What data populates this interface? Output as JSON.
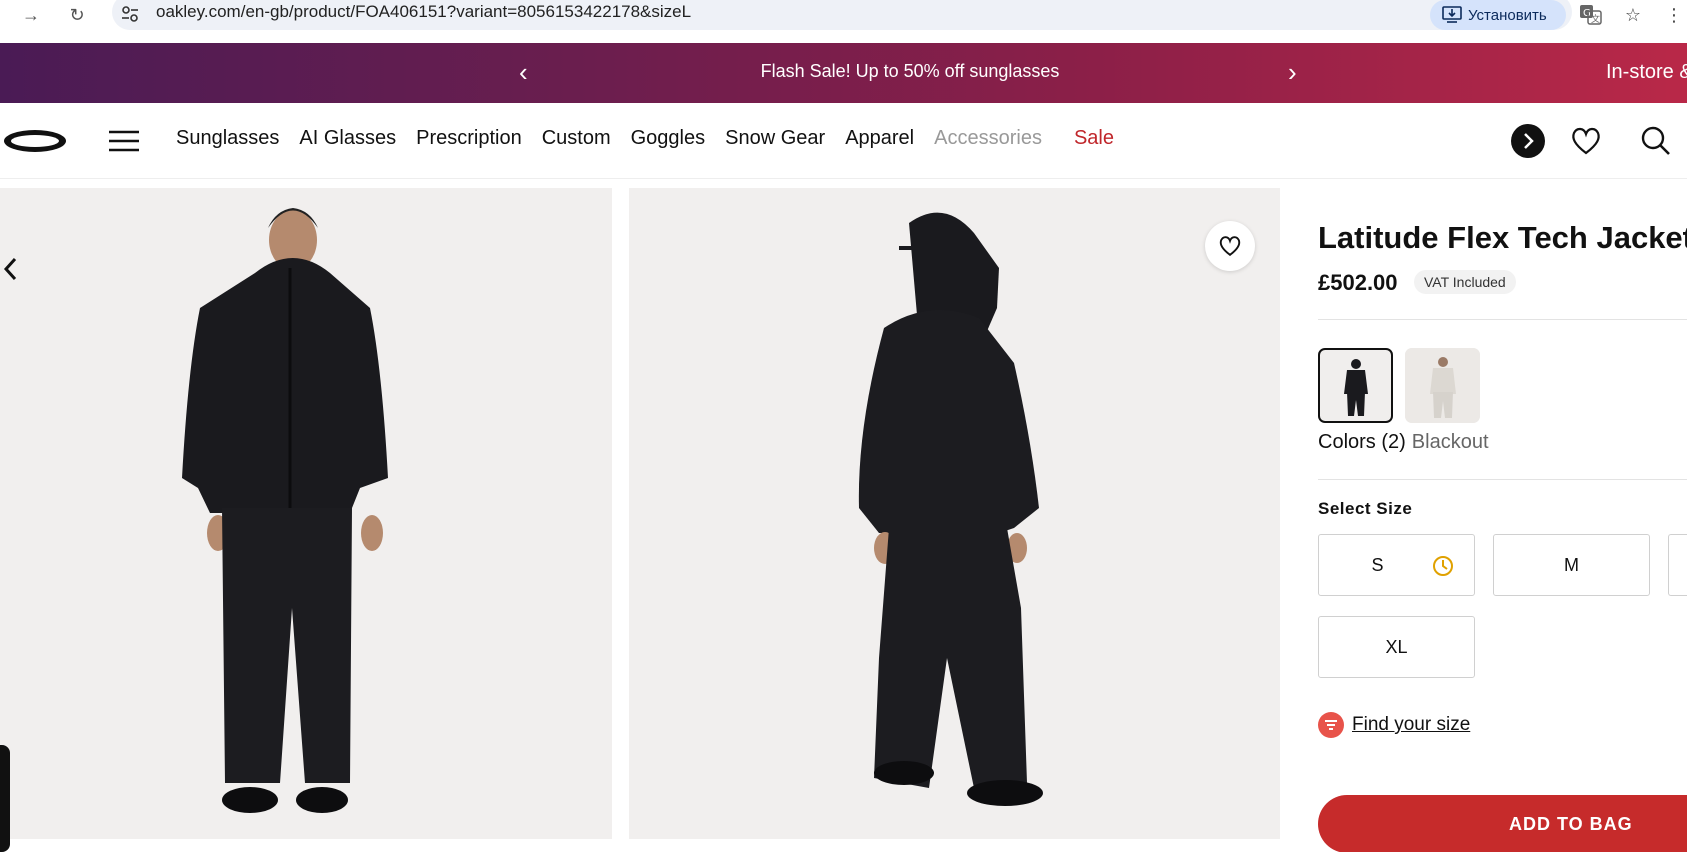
{
  "browser": {
    "url": "oakley.com/en-gb/product/FOA406151?variant=8056153422178&sizeL",
    "install_label": "Установить",
    "icons": [
      "forward-icon",
      "reload-icon",
      "site-settings-icon",
      "install-icon",
      "translate-icon",
      "star-icon"
    ]
  },
  "promo": {
    "message": "Flash Sale! Up to 50% off sunglasses",
    "next_message": "In-store &",
    "prev_arrow": "‹",
    "next_arrow": "›"
  },
  "nav": {
    "items": [
      "Sunglasses",
      "AI Glasses",
      "Prescription",
      "Custom",
      "Goggles",
      "Snow Gear",
      "Apparel",
      "Accessories"
    ],
    "sale": "Sale",
    "colors": {
      "sale": "#c0262b",
      "muted": "#999999"
    }
  },
  "product": {
    "title": "Latitude Flex Tech Jacket",
    "price": "£502.00",
    "vat": "VAT Included",
    "colors_label": "Colors (2)",
    "selected_color": "Blackout",
    "swatches": [
      "Blackout",
      "White"
    ],
    "size_heading": "Select Size",
    "sizes": [
      {
        "label": "S",
        "low_stock": true
      },
      {
        "label": "M",
        "low_stock": false
      },
      {
        "label": "XL",
        "low_stock": false
      }
    ],
    "find_size": "Find your size",
    "add_to_bag": "ADD TO BAG",
    "accent": "#c62b2b"
  }
}
